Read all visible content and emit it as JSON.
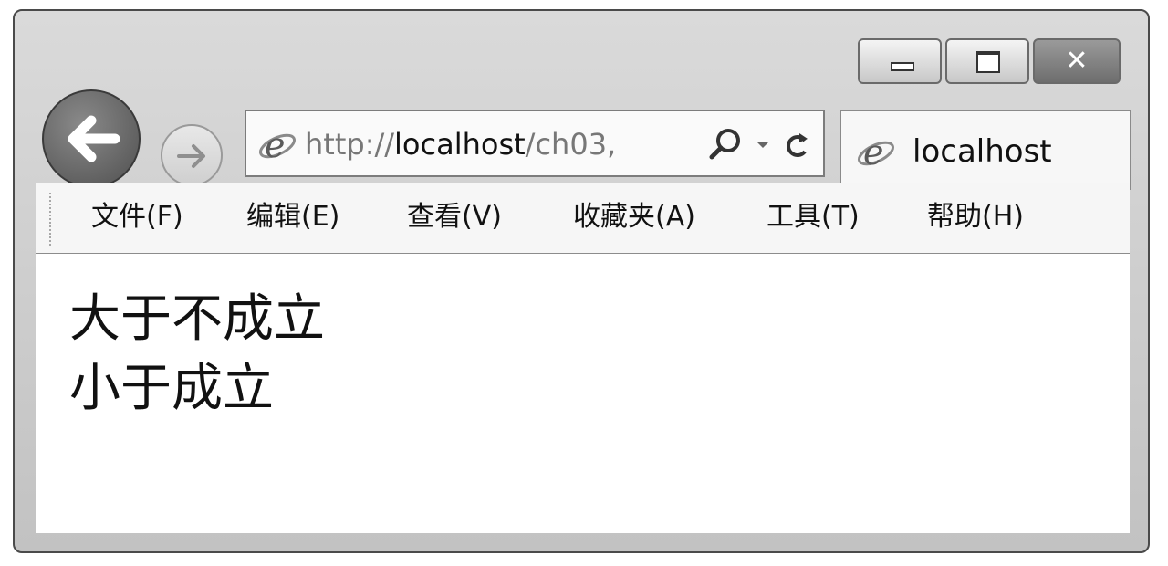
{
  "browser": {
    "address": {
      "prefix": "http://",
      "host": "localhost",
      "path": "/ch03,"
    },
    "tab": {
      "title": "localhost"
    },
    "caption_buttons": {
      "close_glyph": "✕"
    }
  },
  "menu": {
    "items": [
      {
        "label": "文件(F)"
      },
      {
        "label": "编辑(E)"
      },
      {
        "label": "查看(V)"
      },
      {
        "label": "收藏夹(A)"
      },
      {
        "label": "工具(T)"
      },
      {
        "label": "帮助(H)"
      }
    ]
  },
  "content": {
    "lines": [
      "大于不成立",
      "小于成立"
    ]
  },
  "icons": {
    "back": "back-arrow-icon",
    "forward": "forward-arrow-icon",
    "page": "internet-explorer-icon",
    "search": "search-icon",
    "dropdown": "chevron-down-icon",
    "refresh": "refresh-icon"
  }
}
